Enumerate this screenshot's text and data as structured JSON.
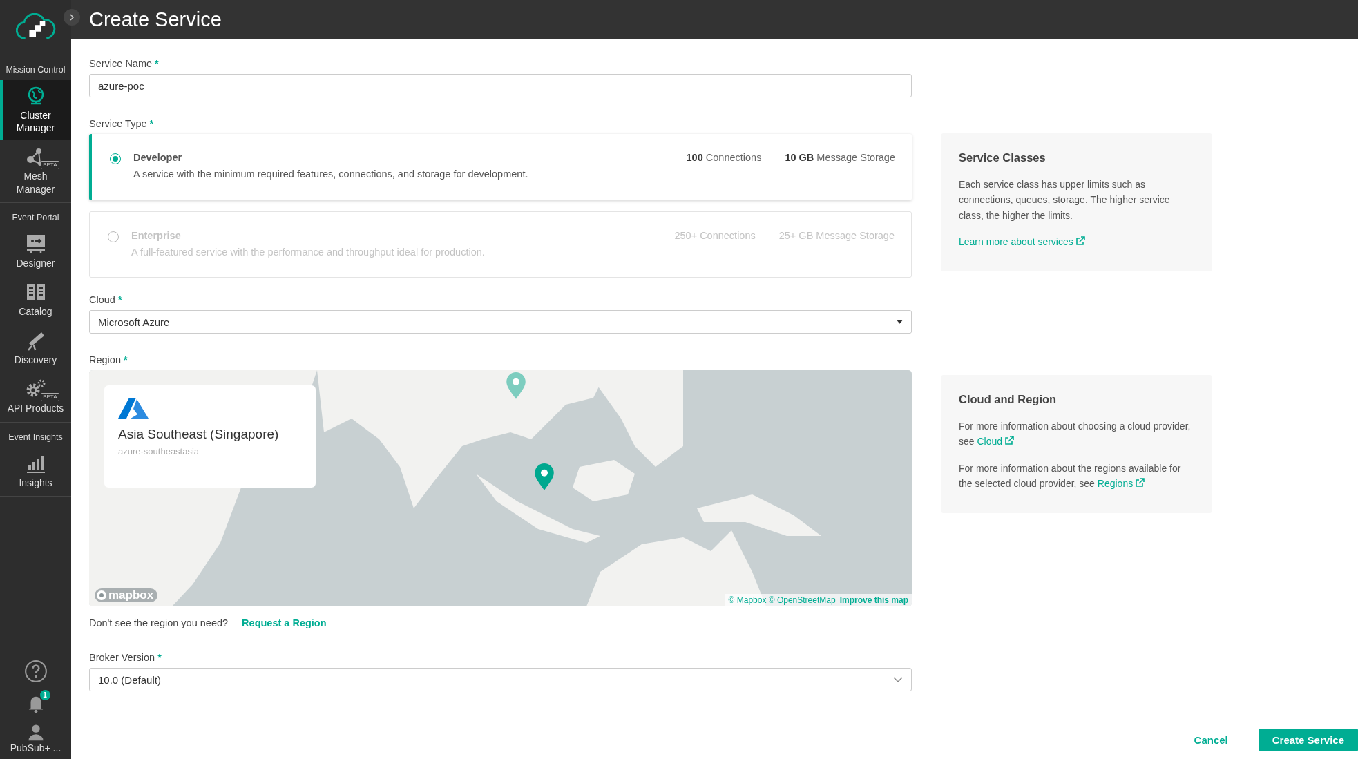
{
  "header": {
    "title": "Create Service"
  },
  "sidebar": {
    "sections": [
      {
        "label": "Mission Control",
        "items": [
          {
            "label": "Cluster Manager",
            "selected": true
          },
          {
            "label": "Mesh Manager",
            "badge": "BETA",
            "selected": false
          }
        ]
      },
      {
        "label": "Event Portal",
        "items": [
          {
            "label": "Designer",
            "selected": false
          },
          {
            "label": "Catalog",
            "selected": false
          },
          {
            "label": "Discovery",
            "selected": false
          },
          {
            "label": "API Products",
            "badge": "BETA",
            "selected": false
          }
        ]
      },
      {
        "label": "Event Insights",
        "items": [
          {
            "label": "Insights",
            "selected": false
          }
        ]
      }
    ],
    "notifications": {
      "count": "1"
    },
    "user": {
      "label": "PubSub+ ..."
    }
  },
  "form": {
    "service_name": {
      "label": "Service Name",
      "required_mark": "*",
      "value": "azure-poc"
    },
    "service_type": {
      "label": "Service Type",
      "required_mark": "*",
      "options": [
        {
          "name": "Developer",
          "description": "A service with the minimum required features, connections, and storage for development.",
          "connections": "**100** Connections",
          "storage": "**10 GB** Message Storage",
          "selected": true,
          "disabled": false
        },
        {
          "name": "Enterprise",
          "description": "A full-featured service with the performance and throughput ideal for production.",
          "connections": "250+ Connections",
          "storage": "25+ GB Message Storage",
          "selected": false,
          "disabled": true
        }
      ]
    },
    "cloud": {
      "label": "Cloud",
      "required_mark": "*",
      "value": "Microsoft Azure"
    },
    "region": {
      "label": "Region",
      "required_mark": "*",
      "card": {
        "title": "Asia Southeast (Singapore)",
        "subtitle": "azure-southeastasia"
      },
      "map_logo": "mapbox",
      "attribution": "© Mapbox © OpenStreetMap",
      "improve_link": "Improve this map"
    },
    "request": {
      "text": "Don't see the region you need?",
      "link": "Request a Region"
    },
    "broker_version": {
      "label": "Broker Version",
      "required_mark": "*",
      "value": "10.0 (Default)"
    }
  },
  "info_panels": [
    {
      "title": "Service Classes",
      "paragraphs": [
        {
          "text": "Each service class has upper limits such as connections, queues, storage. The higher service class, the higher the limits."
        },
        {
          "link": "Learn more about services"
        }
      ]
    },
    {
      "title": "Cloud and Region",
      "paragraphs": [
        {
          "text": "For more information about choosing a cloud provider, see",
          "link": "Cloud"
        },
        {
          "text": "For more information about the regions available for the selected cloud provider, see",
          "link": "Regions"
        }
      ]
    }
  ],
  "actions": {
    "cancel": "Cancel",
    "submit": "Create Service"
  }
}
